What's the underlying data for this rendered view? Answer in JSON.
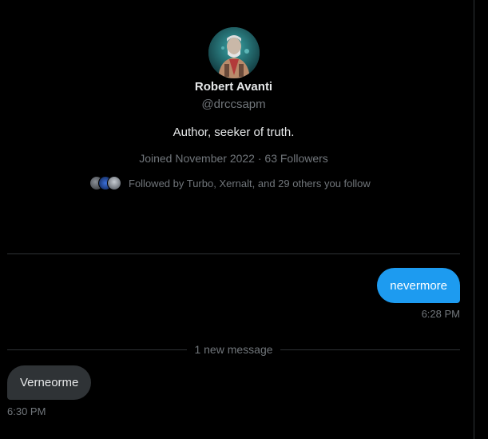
{
  "profile": {
    "display_name": "Robert Avanti",
    "handle": "@drccsapm",
    "bio": "Author, seeker of truth.",
    "joined": "Joined November 2022",
    "separator": "·",
    "followers": "63 Followers",
    "followed_by": "Followed by Turbo, Xernalt, and 29 others you follow"
  },
  "messages": {
    "outgoing": {
      "text": "nevermore",
      "time": "6:28 PM"
    },
    "new_message_label": "1 new message",
    "incoming": {
      "text": "Verneorme",
      "time": "6:30 PM"
    }
  },
  "colors": {
    "background": "#000000",
    "accent": "#1d9bf0",
    "incoming_bubble": "#2f3336",
    "secondary_text": "#71767b",
    "divider": "#2f3336"
  },
  "icons": {
    "avatar": "profile-avatar-image",
    "follower_avatars": "follower-avatar-stack"
  }
}
